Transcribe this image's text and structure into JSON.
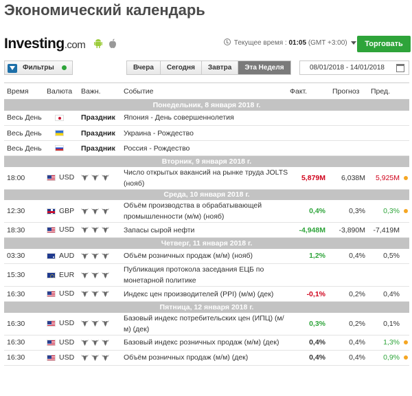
{
  "page_title": "Экономический календарь",
  "brand": {
    "logo_main": "Investing",
    "logo_suffix": ".com",
    "time_label": "Текущее время :",
    "time_value": "01:05",
    "timezone": "(GMT +3:00)",
    "trade_button": "Торговать"
  },
  "toolbar": {
    "filters_label": "Фильтры",
    "tabs": [
      {
        "label": "Вчера"
      },
      {
        "label": "Сегодня"
      },
      {
        "label": "Завтра"
      },
      {
        "label": "Эта Неделя",
        "active": true
      }
    ],
    "date_range": "08/01/2018 - 14/01/2018"
  },
  "table": {
    "headers": {
      "time": "Время",
      "currency": "Валюта",
      "importance": "Важн.",
      "event": "Событие",
      "actual": "Факт.",
      "forecast": "Прогноз",
      "previous": "Пред."
    },
    "days": [
      {
        "label": "Понедельник, 8 января 2018 г.",
        "events": [
          {
            "time": "Весь День",
            "flag": "jp",
            "currency": "",
            "importance": "Праздник",
            "event": "Япония - День совершеннолетия",
            "actual": "",
            "forecast": "",
            "previous": ""
          },
          {
            "time": "Весь День",
            "flag": "ua",
            "currency": "",
            "importance": "Праздник",
            "event": "Украина - Рождество",
            "actual": "",
            "forecast": "",
            "previous": ""
          },
          {
            "time": "Весь День",
            "flag": "ru",
            "currency": "",
            "importance": "Праздник",
            "event": "Россия - Рождество",
            "actual": "",
            "forecast": "",
            "previous": ""
          }
        ]
      },
      {
        "label": "Вторник, 9 января 2018 г.",
        "events": [
          {
            "time": "18:00",
            "flag": "us",
            "currency": "USD",
            "bulls": 3,
            "event": "Число открытых вакансий на рынке труда JOLTS (нояб)",
            "actual": "5,879M",
            "actual_color": "neg",
            "forecast": "6,038M",
            "previous": "5,925M",
            "previous_color": "neg",
            "dot": true
          }
        ]
      },
      {
        "label": "Среда, 10 января 2018 г.",
        "events": [
          {
            "time": "12:30",
            "flag": "gb",
            "currency": "GBP",
            "bulls": 3,
            "event": "Объём производства в обрабатывающей промышленности (м/м) (нояб)",
            "actual": "0,4%",
            "actual_color": "pos",
            "forecast": "0,3%",
            "previous": "0,3%",
            "previous_color": "pos",
            "dot": true
          },
          {
            "time": "18:30",
            "flag": "us",
            "currency": "USD",
            "bulls": 3,
            "event": "Запасы сырой нефти",
            "actual": "-4,948M",
            "actual_color": "pos",
            "forecast": "-3,890M",
            "previous": "-7,419M"
          }
        ]
      },
      {
        "label": "Четверг, 11 января 2018 г.",
        "events": [
          {
            "time": "03:30",
            "flag": "au",
            "currency": "AUD",
            "bulls": 3,
            "event": "Объём розничных продаж (м/м) (нояб)",
            "actual": "1,2%",
            "actual_color": "pos",
            "forecast": "0,4%",
            "previous": "0,5%"
          },
          {
            "time": "15:30",
            "flag": "eu",
            "currency": "EUR",
            "bulls": 3,
            "event": "Публикация протокола заседания ЕЦБ по монетарной политике",
            "actual": "",
            "forecast": "",
            "previous": ""
          },
          {
            "time": "16:30",
            "flag": "us",
            "currency": "USD",
            "bulls": 3,
            "event": "Индекс цен производителей (PPI) (м/м) (дек)",
            "actual": "-0,1%",
            "actual_color": "neg",
            "forecast": "0,2%",
            "previous": "0,4%"
          }
        ]
      },
      {
        "label": "Пятница, 12 января 2018 г.",
        "events": [
          {
            "time": "16:30",
            "flag": "us",
            "currency": "USD",
            "bulls": 3,
            "event": "Базовый индекс потребительских цен (ИПЦ) (м/м) (дек)",
            "actual": "0,3%",
            "actual_color": "pos",
            "forecast": "0,2%",
            "previous": "0,1%"
          },
          {
            "time": "16:30",
            "flag": "us",
            "currency": "USD",
            "bulls": 3,
            "event": "Базовый индекс розничных продаж (м/м) (дек)",
            "actual": "0,4%",
            "forecast": "0,4%",
            "previous": "1,3%",
            "previous_color": "pos",
            "dot": true
          },
          {
            "time": "16:30",
            "flag": "us",
            "currency": "USD",
            "bulls": 3,
            "event": "Объём розничных продаж (м/м) (дек)",
            "actual": "0,4%",
            "forecast": "0,4%",
            "previous": "0,9%",
            "previous_color": "pos",
            "dot": true
          }
        ]
      }
    ]
  },
  "colors": {
    "trade_green": "#2ea43a",
    "negative_red": "#d0021b",
    "positive_green": "#2ea43a",
    "day_header_bg": "#c3c3c3",
    "dot_orange": "#f5a623"
  }
}
